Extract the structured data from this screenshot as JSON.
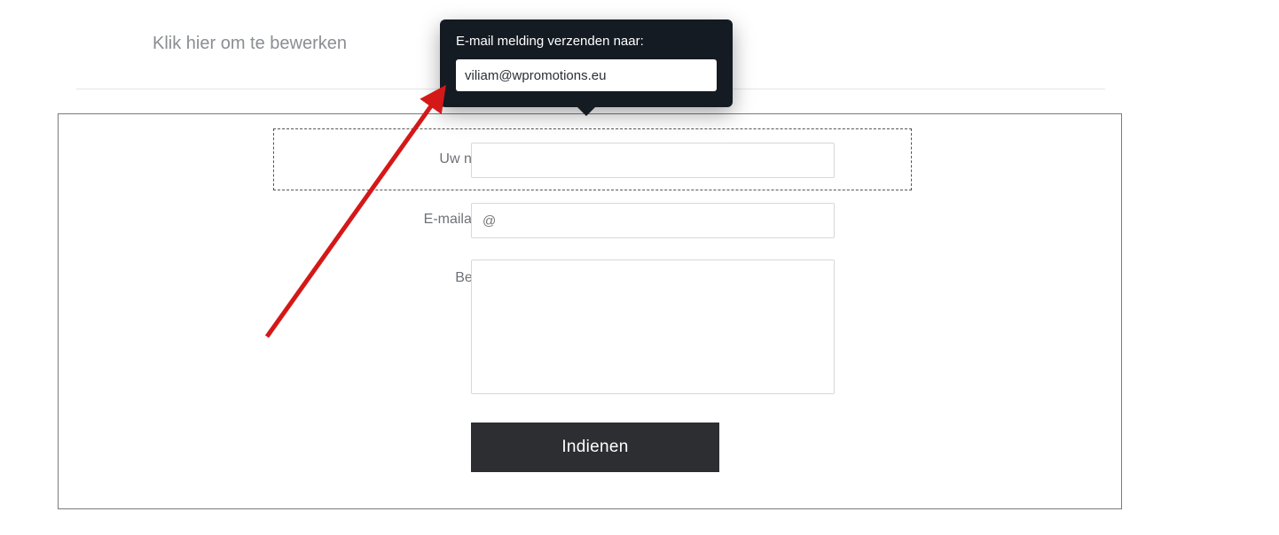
{
  "editor": {
    "edit_placeholder": "Klik hier om te bewerken"
  },
  "tooltip": {
    "title": "E-mail melding verzenden naar:",
    "email_value": "viliam@wpromotions.eu"
  },
  "form": {
    "fields": {
      "name": {
        "label": "Uw naam",
        "value": ""
      },
      "email": {
        "label": "E-mailadres",
        "value": "",
        "placeholder": "@"
      },
      "message": {
        "label": "Bericht",
        "value": ""
      }
    },
    "submit_label": "Indienen"
  },
  "colors": {
    "tooltip_bg": "#141b23",
    "submit_bg": "#2d2e31",
    "arrow": "#d41818"
  }
}
